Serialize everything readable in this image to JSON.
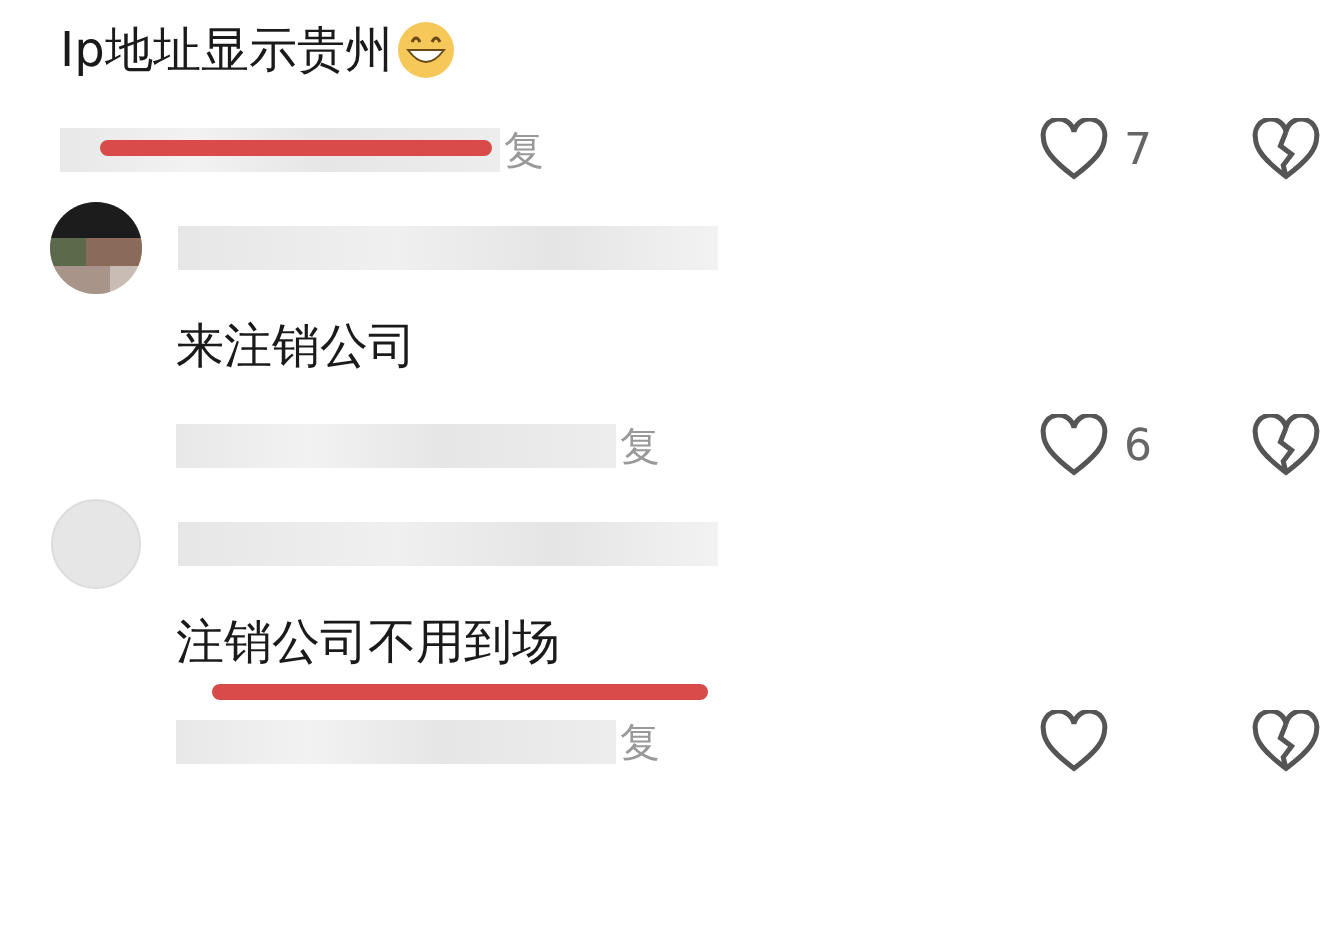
{
  "comments": [
    {
      "kind": "top",
      "text": "Ip地址显示贵州",
      "emoji": true,
      "reply_label": "复",
      "likes": "7",
      "underlined": true
    },
    {
      "kind": "reply",
      "text": "来注销公司",
      "emoji": false,
      "reply_label": "复",
      "likes": "6",
      "underlined": false
    },
    {
      "kind": "reply",
      "text": "注销公司不用到场",
      "emoji": false,
      "reply_label": "复",
      "underlined": true
    }
  ]
}
